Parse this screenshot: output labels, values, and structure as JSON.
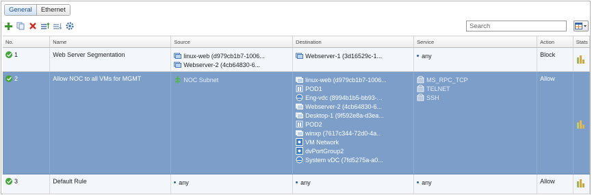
{
  "tabs": [
    {
      "label": "General",
      "active": true
    },
    {
      "label": "Ethernet",
      "active": false
    }
  ],
  "toolbar": {
    "icons": [
      "add-icon",
      "copy-icon",
      "delete-icon",
      "move-up-icon",
      "move-down-icon",
      "settings-icon"
    ]
  },
  "search": {
    "placeholder": "Search"
  },
  "columns": {
    "no": "No.",
    "name": "Name",
    "source": "Source",
    "destination": "Destination",
    "service": "Service",
    "action": "Action",
    "stats": "Stats"
  },
  "rules": [
    {
      "no": "1",
      "enabled": true,
      "name": "Web Server Segmentation",
      "source": [
        "linux-web (d979cb1b7-1006...",
        "Webserver-2 (4cb64830-6..."
      ],
      "destination": [
        "Webserver-1 (3d16529c-1..."
      ],
      "service": [
        "any"
      ],
      "action": "Block",
      "selected": false
    },
    {
      "no": "2",
      "enabled": true,
      "name": "Allow NOC to all VMs for MGMT",
      "source": [
        "NOC Subnet"
      ],
      "destination": [
        "linux-web (d979cb1b7-1006...",
        "POD1",
        "Eng-vdc (8994b1b5-bb93-...",
        "Webserver-2 (4cb64830-6...",
        "Desktop-1 (9f592e8a-d3ea...",
        "POD2",
        "winxp (7617c344-72d0-4a...",
        "VM Network",
        "dvPortGroup2",
        "System vDC (7fd5275a-a0..."
      ],
      "service": [
        "MS_RPC_TCP",
        "TELNET",
        "SSH"
      ],
      "action": "Allow",
      "selected": true
    },
    {
      "no": "3",
      "enabled": true,
      "name": "Default Rule",
      "source": [
        "any"
      ],
      "destination": [
        "any"
      ],
      "service": [
        "any"
      ],
      "action": "Allow",
      "selected": false
    }
  ],
  "colors": {
    "selected_row": "#7c9ec9",
    "enabled_check": "#46a43b",
    "tab_active": "#cfe0f3"
  }
}
